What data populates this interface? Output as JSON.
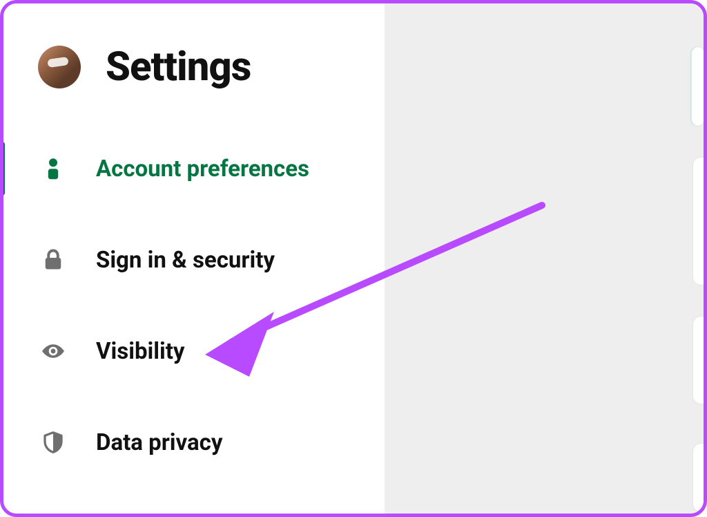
{
  "header": {
    "title": "Settings"
  },
  "sidebar": {
    "items": [
      {
        "label": "Account preferences",
        "icon": "person-icon",
        "active": true
      },
      {
        "label": "Sign in & security",
        "icon": "lock-icon",
        "active": false
      },
      {
        "label": "Visibility",
        "icon": "eye-icon",
        "active": false
      },
      {
        "label": "Data privacy",
        "icon": "shield-icon",
        "active": false
      }
    ]
  },
  "colors": {
    "accent": "#057642",
    "annotation": "#b84bff"
  },
  "annotation": {
    "type": "arrow",
    "target": "Visibility"
  }
}
